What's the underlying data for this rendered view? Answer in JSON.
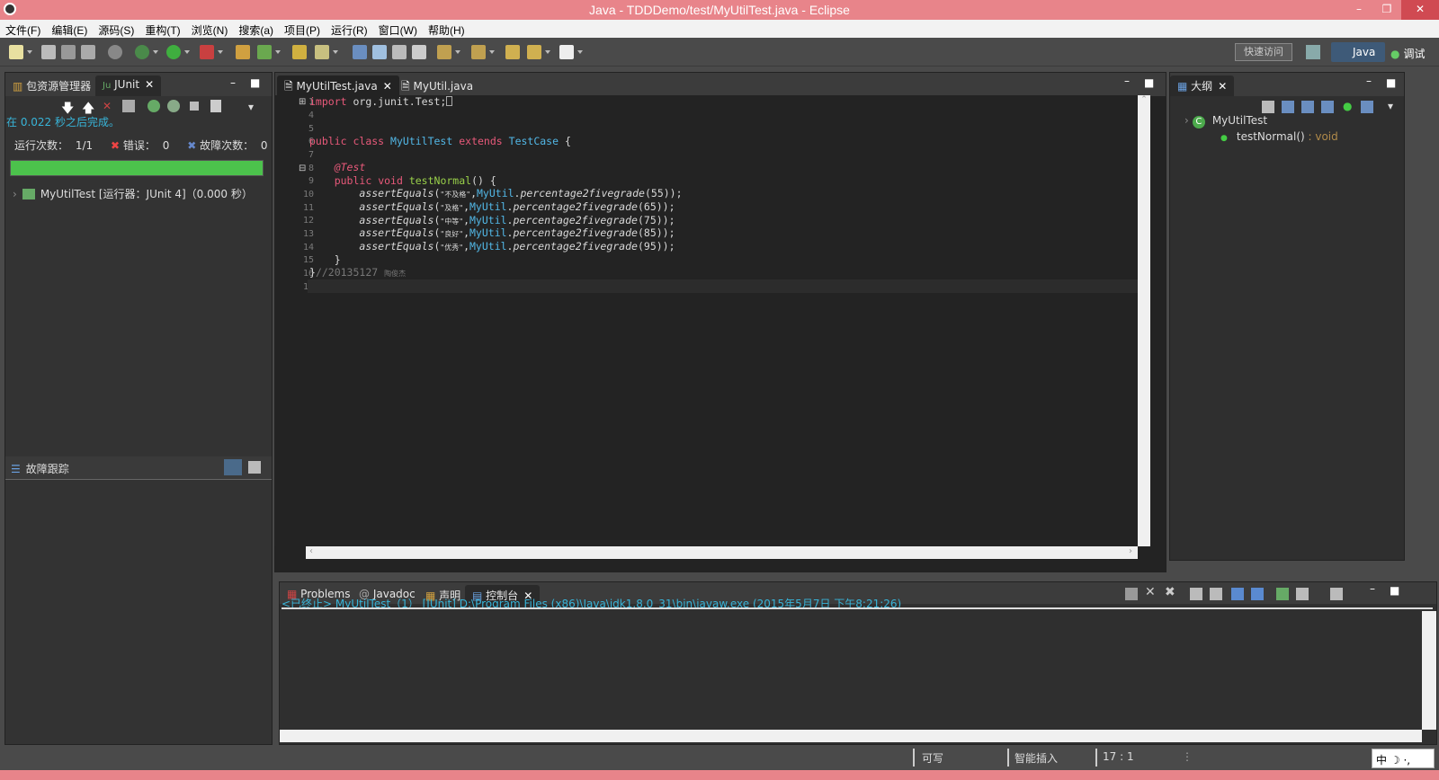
{
  "window": {
    "title": "Java - TDDDemo/test/MyUtilTest.java - Eclipse"
  },
  "menu": [
    "文件(F)",
    "编辑(E)",
    "源码(S)",
    "重构(T)",
    "浏览(N)",
    "搜索(a)",
    "项目(P)",
    "运行(R)",
    "窗口(W)",
    "帮助(H)"
  ],
  "toolbar": {
    "quick_access": "快速访问",
    "perspective_java": "Java",
    "perspective_debug": "调试"
  },
  "left_panel": {
    "tabs": [
      "包资源管理器",
      "JUnit"
    ],
    "finished": "在 0.022 秒之后完成。",
    "runs_label": "运行次数：",
    "runs_value": "1/1",
    "errors_label": "错误：",
    "errors_value": "0",
    "failures_label": "故障次数：",
    "failures_value": "0",
    "progress": 1.0,
    "progress_color": "#4cc24c",
    "tree_item": "MyUtilTest [运行器：JUnit 4]（0.000 秒）",
    "failure_trace": "故障跟踪"
  },
  "editor": {
    "tabs": [
      "MyUtilTest.java",
      "MyUtil.java"
    ],
    "line_numbers": [
      "1",
      "4",
      "5",
      "6",
      "7",
      "8",
      "9",
      "10",
      "11",
      "12",
      "13",
      "14",
      "15",
      "16",
      "17"
    ],
    "import_kw": "import",
    "import_rest": " org.junit.Test;",
    "class_decl": {
      "public": "public",
      "class": "class",
      "name": "MyUtilTest",
      "extends": "extends",
      "super": "TestCase",
      "brace": " {"
    },
    "annotation": "@Test",
    "method_decl": {
      "public": "public",
      "void": "void",
      "name": "testNormal",
      "rest": "() {"
    },
    "asserts": [
      {
        "call": "assertEquals",
        "arg": "\"不及格\"",
        "cls": "MyUtil",
        "m": "percentage2fivegrade",
        "n": "(55));"
      },
      {
        "call": "assertEquals",
        "arg": "\"及格\"",
        "cls": "MyUtil",
        "m": "percentage2fivegrade",
        "n": "(65));"
      },
      {
        "call": "assertEquals",
        "arg": "\"中等\"",
        "cls": "MyUtil",
        "m": "percentage2fivegrade",
        "n": "(75));"
      },
      {
        "call": "assertEquals",
        "arg": "\"良好\"",
        "cls": "MyUtil",
        "m": "percentage2fivegrade",
        "n": "(85));"
      },
      {
        "call": "assertEquals",
        "arg": "\"优秀\"",
        "cls": "MyUtil",
        "m": "percentage2fivegrade",
        "n": "(95));"
      }
    ],
    "close_method": "}",
    "close_class": "}",
    "comment": "//20135127",
    "comment_name": "陶俊杰"
  },
  "outline": {
    "tab": "大纲",
    "class_name": "MyUtilTest",
    "method": "testNormal()",
    "method_type": " : void"
  },
  "console": {
    "tabs": [
      "Problems",
      "Javadoc",
      "声明",
      "控制台"
    ],
    "terminated": "<已终止> MyUtilTest（1） [JUnit] D:\\Program Files (x86)\\Java\\jdk1.8.0_31\\bin\\javaw.exe (2015年5月7日 下午8:21:26)"
  },
  "status": {
    "writable": "可写",
    "insert": "智能插入",
    "position": "17 : 1"
  },
  "ime": [
    "中",
    "☽",
    "·,"
  ]
}
